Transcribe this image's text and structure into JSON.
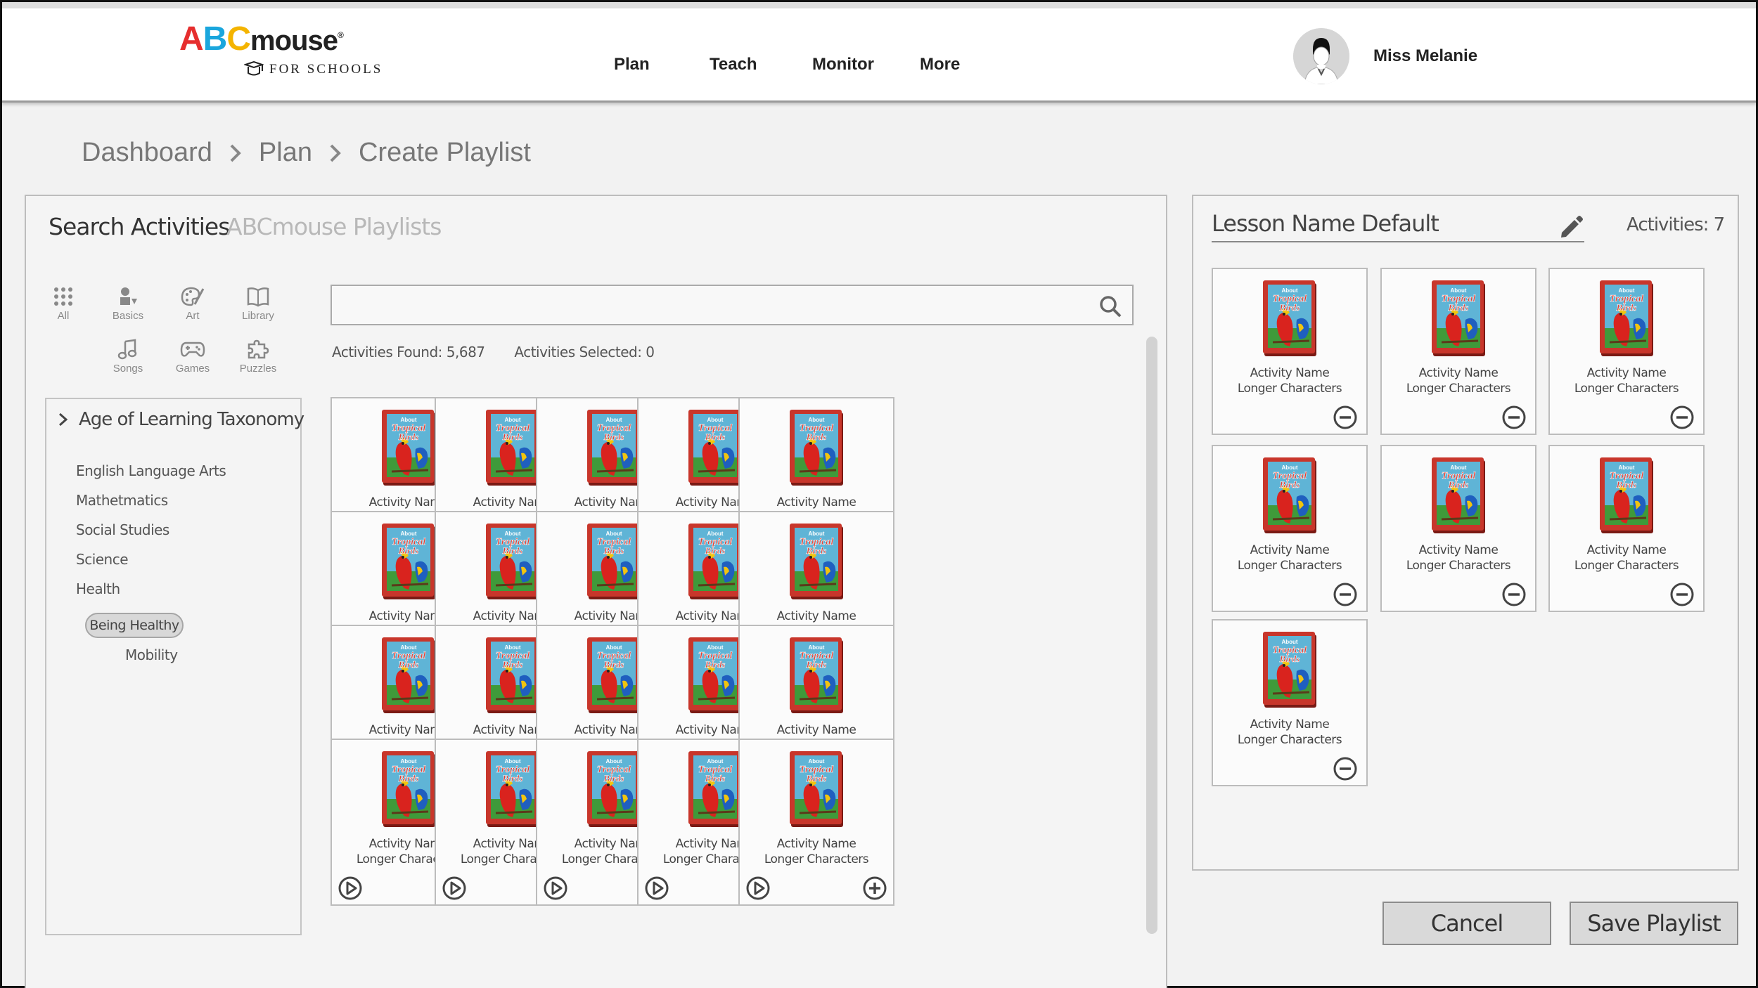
{
  "app": {
    "logo_letters": [
      "A",
      "B",
      "C"
    ],
    "logo_word": "mouse",
    "logo_registered": "®",
    "logo_sub": "FOR SCHOOLS"
  },
  "nav": {
    "items": [
      {
        "label": "Plan"
      },
      {
        "label": "Teach"
      },
      {
        "label": "Monitor"
      },
      {
        "label": "More"
      }
    ]
  },
  "user": {
    "name": "Miss Melanie"
  },
  "breadcrumb": [
    "Dashboard",
    "Plan",
    "Create Playlist"
  ],
  "tabs": {
    "search": "Search Activities",
    "playlists": "ABCmouse Playlists"
  },
  "categories": [
    {
      "label": "All",
      "icon": "grid-icon"
    },
    {
      "label": "Basics",
      "icon": "basics-icon"
    },
    {
      "label": "Art",
      "icon": "palette-icon"
    },
    {
      "label": "Library",
      "icon": "book-icon"
    },
    {
      "label": "Songs",
      "icon": "music-note-icon"
    },
    {
      "label": "Games",
      "icon": "gamepad-icon"
    },
    {
      "label": "Puzzles",
      "icon": "puzzle-icon"
    }
  ],
  "taxonomy": {
    "heading": "Age of Learning Taxonomy",
    "subjects": [
      "English Language Arts",
      "Mathetmatics",
      "Social Studies",
      "Science",
      "Health"
    ],
    "selected": "Being Healthy",
    "child": "Mobility"
  },
  "search": {
    "value": "",
    "placeholder": ""
  },
  "stats": {
    "found": "Activities Found: 5,687",
    "selected": "Activities Selected: 0"
  },
  "activity": {
    "name_line1": "Activity Name",
    "name_line2": "Longer Characters",
    "cover_line1": "About",
    "cover_line2": "Tropical",
    "cover_line3": "Birds"
  },
  "playlist": {
    "lesson_name": "Lesson Name Default",
    "activities_count": "Activities: 7"
  },
  "buttons": {
    "cancel": "Cancel",
    "save": "Save Playlist"
  },
  "colors": {
    "book_red": "#c8362b",
    "book_cover": "#5fb4d6",
    "parrot_red": "#d9231e",
    "logo_red": "#e62e2e",
    "logo_blue": "#1aa6dd",
    "logo_yellow": "#f4b400"
  }
}
